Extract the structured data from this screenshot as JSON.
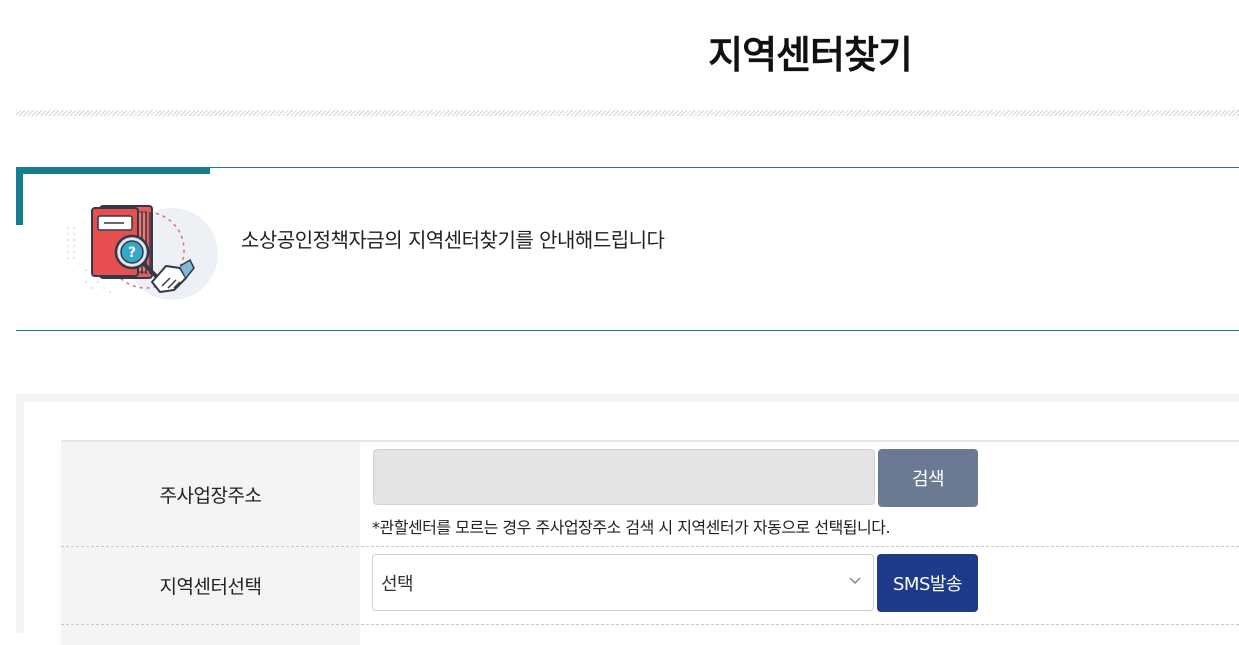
{
  "page": {
    "title": "지역센터찾기"
  },
  "intro": {
    "text": "소상공인정책자금의 지역센터찾기를 안내해드립니다",
    "illustration_icon": "book-magnifier-handshake-icon",
    "accent_color": "#167f8e"
  },
  "form": {
    "address_row": {
      "label": "주사업장주소",
      "input_value": "",
      "search_button": "검색",
      "hint": "*관할센터를 모르는 경우 주사업장주소 검색 시 지역센터가 자동으로 선택됩니다."
    },
    "center_row": {
      "label": "지역센터선택",
      "select_value": "선택",
      "sms_button": "SMS발송"
    }
  },
  "colors": {
    "search_button": "#6b7a93",
    "sms_button": "#1e3a8a",
    "line": "#1f7a8c"
  }
}
